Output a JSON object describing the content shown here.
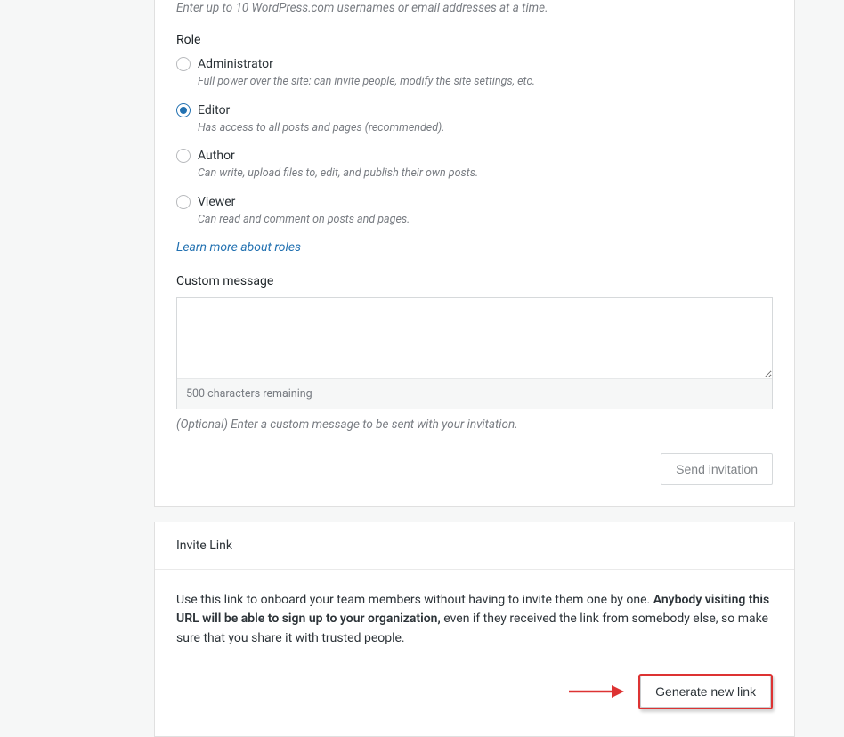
{
  "usernames_hint": "Enter up to 10 WordPress.com usernames or email addresses at a time.",
  "role_label": "Role",
  "roles": [
    {
      "label": "Administrator",
      "desc": "Full power over the site: can invite people, modify the site settings, etc.",
      "checked": false
    },
    {
      "label": "Editor",
      "desc": "Has access to all posts and pages (recommended).",
      "checked": true
    },
    {
      "label": "Author",
      "desc": "Can write, upload files to, edit, and publish their own posts.",
      "checked": false
    },
    {
      "label": "Viewer",
      "desc": "Can read and comment on posts and pages.",
      "checked": false
    }
  ],
  "learn_more": "Learn more about roles",
  "custom_message_label": "Custom message",
  "message_value": "",
  "characters_remaining": "500 characters remaining",
  "custom_message_hint": "(Optional) Enter a custom message to be sent with your invitation.",
  "send_button": "Send invitation",
  "invite_link": {
    "header": "Invite Link",
    "body_part1": "Use this link to onboard your team members without having to invite them one by one. ",
    "body_bold": "Anybody visiting this URL will be able to sign up to your organization,",
    "body_part2": " even if they received the link from somebody else, so make sure that you share it with trusted people.",
    "button": "Generate new link"
  }
}
